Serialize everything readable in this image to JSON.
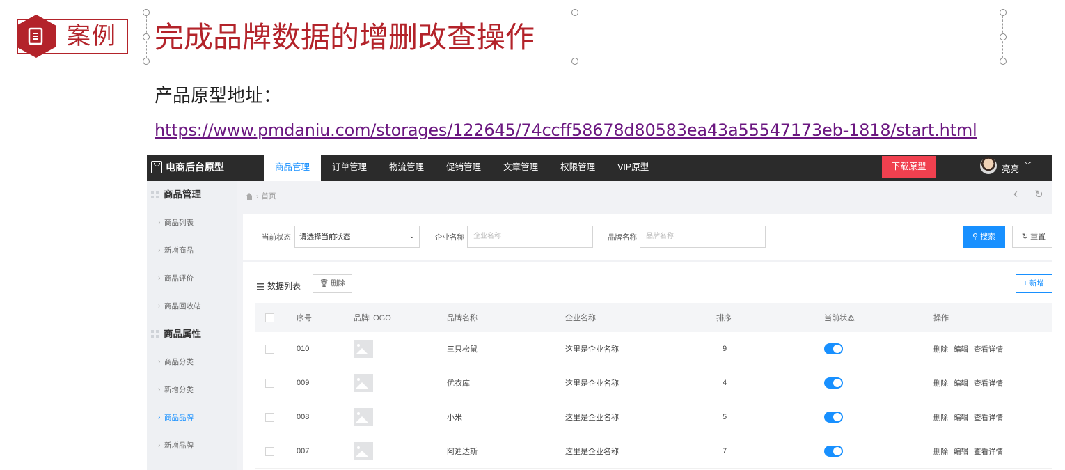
{
  "slide": {
    "badge": "案例",
    "title": "完成品牌数据的增删改查操作",
    "proto_label": "产品原型地址：",
    "proto_link": "https://www.pmdaniu.com/storages/122645/74ccff58678d80583ea43a55547173eb-1818/start.html"
  },
  "app": {
    "brand": "电商后台原型",
    "nav": [
      "商品管理",
      "订单管理",
      "物流管理",
      "促销管理",
      "文章管理",
      "权限管理",
      "VIP原型"
    ],
    "download": "下载原型",
    "user": "亮亮"
  },
  "sidebar": {
    "groups": [
      {
        "title": "商品管理",
        "items": [
          "商品列表",
          "新增商品",
          "商品评价",
          "商品回收站"
        ]
      },
      {
        "title": "商品属性",
        "items": [
          "商品分类",
          "新增分类",
          "商品品牌",
          "新增品牌"
        ]
      }
    ],
    "active_item": "商品品牌"
  },
  "breadcrumb": {
    "home": "首页"
  },
  "filter": {
    "status_label": "当前状态",
    "status_value": "请选择当前状态",
    "company_label": "企业名称",
    "company_placeholder": "企业名称",
    "brand_label": "品牌名称",
    "brand_placeholder": "品牌名称",
    "search": "搜索",
    "reset": "重置"
  },
  "list": {
    "title": "数据列表",
    "delete": "删除",
    "add": "+ 新增",
    "columns": [
      "序号",
      "品牌LOGO",
      "品牌名称",
      "企业名称",
      "排序",
      "当前状态",
      "操作"
    ],
    "rows": [
      {
        "id": "010",
        "brand": "三只松鼠",
        "company": "这里是企业名称",
        "order": "9",
        "enabled": true
      },
      {
        "id": "009",
        "brand": "优衣库",
        "company": "这里是企业名称",
        "order": "4",
        "enabled": true
      },
      {
        "id": "008",
        "brand": "小米",
        "company": "这里是企业名称",
        "order": "5",
        "enabled": true
      },
      {
        "id": "007",
        "brand": "阿迪达斯",
        "company": "这里是企业名称",
        "order": "7",
        "enabled": true
      }
    ],
    "row_actions": [
      "删除",
      "编辑",
      "查看详情"
    ]
  }
}
